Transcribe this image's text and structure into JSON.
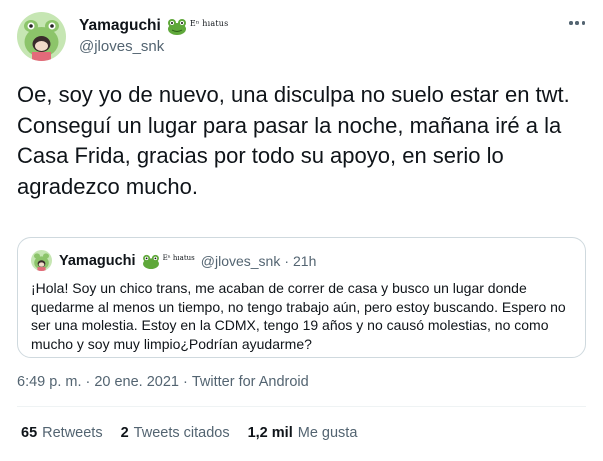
{
  "author": {
    "display_name": "Yamaguchi",
    "hiatus_tag": "Eⁿ hıatus",
    "handle": "@jloves_snk"
  },
  "tweet": {
    "paragraphs": [
      "Oe, soy yo de nuevo, una disculpa no suelo estar en twt.",
      "Conseguí un lugar para pasar la noche, mañana iré a la Casa Frida, gracias por todo su apoyo, en serio lo agradezco mucho."
    ]
  },
  "quoted_tweet": {
    "display_name": "Yamaguchi",
    "hiatus_tag": "Eⁿ hıatus",
    "handle": "@jloves_snk",
    "separator": "·",
    "time": "21h",
    "text": "¡Hola! Soy un chico trans, me acaban de correr de casa y busco un lugar donde quedarme al menos un tiempo, no tengo trabajo aún, pero estoy buscando. Espero no ser una molestia. Estoy en la CDMX, tengo 19 años y no causó molestias, no como mucho y soy muy limpio¿Podrían ayudarme?"
  },
  "meta": {
    "time": "6:49 p. m.",
    "separator": "·",
    "date": "20 ene. 2021",
    "source": "Twitter for Android"
  },
  "stats": {
    "retweets_count": "65",
    "retweets_label": "Retweets",
    "quotes_count": "2",
    "quotes_label": "Tweets citados",
    "likes_count": "1,2 mil",
    "likes_label": "Me gusta"
  },
  "icons": {
    "more": "more-dots-icon",
    "frog": "frog-emoji-icon"
  },
  "colors": {
    "text": "#0f1419",
    "secondary": "#536471",
    "border": "#cfd9de",
    "divider": "#eff3f4",
    "frog_green": "#5fa83a",
    "avatar_bg": "#c6e6b3"
  }
}
